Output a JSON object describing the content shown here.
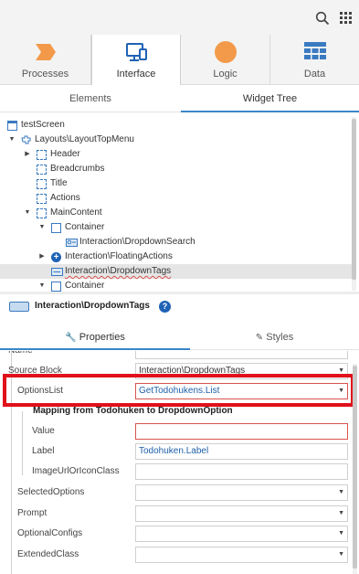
{
  "tabs": [
    {
      "label": "Processes",
      "icon": "processes-icon",
      "color": "#f29a4a"
    },
    {
      "label": "Interface",
      "icon": "interface-icon",
      "color": "#1f62b5"
    },
    {
      "label": "Logic",
      "icon": "logic-icon",
      "color": "#f29a4a"
    },
    {
      "label": "Data",
      "icon": "data-icon",
      "color": "#3a7ac0"
    }
  ],
  "subtabs": {
    "elements": "Elements",
    "widget_tree": "Widget Tree"
  },
  "tree": [
    {
      "label": "testScreen"
    },
    {
      "label": "Layouts\\LayoutTopMenu"
    },
    {
      "label": "Header"
    },
    {
      "label": "Breadcrumbs"
    },
    {
      "label": "Title"
    },
    {
      "label": "Actions"
    },
    {
      "label": "MainContent"
    },
    {
      "label": "Container"
    },
    {
      "label": "Interaction\\DropdownSearch"
    },
    {
      "label": "Interaction\\FloatingActions"
    },
    {
      "label": "Interaction\\DropdownTags"
    },
    {
      "label": "Container"
    }
  ],
  "selected": {
    "name": "Interaction\\DropdownTags",
    "help": "?"
  },
  "panel_tabs": {
    "properties": "Properties",
    "styles": "Styles"
  },
  "props": {
    "name_label": "Name",
    "source_block_label": "Source Block",
    "source_block_value": "Interaction\\DropdownTags",
    "options_list_label": "OptionsList",
    "options_list_value": "GetTodohukens.List",
    "mapping_title": "Mapping from Todohuken to DropdownOption",
    "value_label": "Value",
    "label_label": "Label",
    "label_value": "Todohuken.Label",
    "image_label": "ImageUrlOrIconClass",
    "selected_options_label": "SelectedOptions",
    "prompt_label": "Prompt",
    "optional_configs_label": "OptionalConfigs",
    "extended_class_label": "ExtendedClass"
  },
  "colors": {
    "accent": "#3a86c8",
    "highlight": "#e0111b",
    "link_blue": "#1f5fa8"
  }
}
